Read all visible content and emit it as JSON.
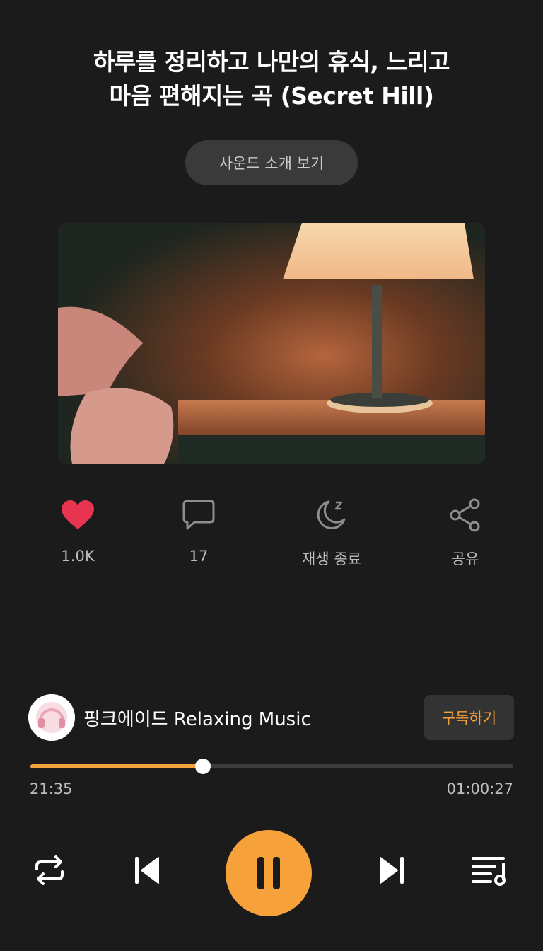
{
  "title": {
    "line1": "하루를 정리하고 나만의 휴식, 느리고",
    "line2": "마음 편해지는 곡 (Secret Hill)"
  },
  "intro_button": "사운드 소개 보기",
  "artwork": {
    "description_icon": "bedside-lamp-image"
  },
  "actions": [
    {
      "name": "like",
      "icon": "heart-icon",
      "label": "1.0K"
    },
    {
      "name": "comments",
      "icon": "comment-icon",
      "label": "17"
    },
    {
      "name": "sleep-timer",
      "icon": "moon-icon",
      "label": "재생 종료"
    },
    {
      "name": "share",
      "icon": "share-icon",
      "label": "공유"
    }
  ],
  "channel": {
    "name": "핑크에이드 Relaxing Music",
    "subscribe_label": "구독하기"
  },
  "player": {
    "elapsed": "21:35",
    "duration": "01:00:27",
    "progress_fraction": 0.357
  },
  "controls": [
    "repeat-icon",
    "previous-icon",
    "pause-icon",
    "next-icon",
    "playlist-icon"
  ],
  "colors": {
    "accent": "#f4a23c",
    "heart": "#e8344f",
    "background": "#1b1b1b"
  }
}
